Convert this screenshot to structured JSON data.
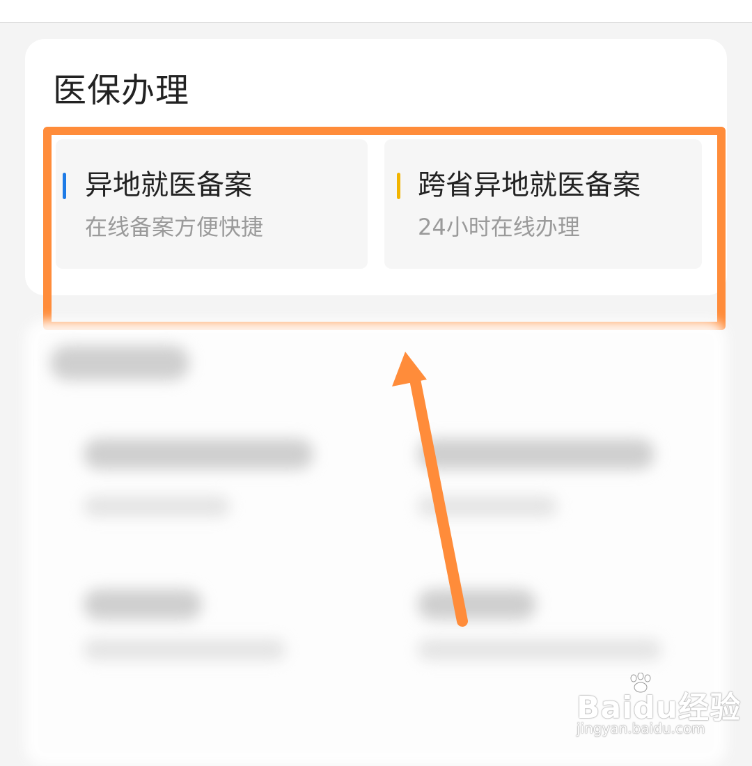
{
  "section": {
    "title": "医保办理"
  },
  "tiles": [
    {
      "title": "异地就医备案",
      "subtitle": "在线备案方便快捷",
      "accent_color": "#1e7be6"
    },
    {
      "title": "跨省异地就医备案",
      "subtitle": "24小时在线办理",
      "accent_color": "#f2b400"
    }
  ],
  "annotation": {
    "highlight_color": "#ff8c3a",
    "arrow_color": "#ff8c3a",
    "icon": "arrow-up-icon"
  },
  "watermark": {
    "brand": "Baidu经验",
    "url": "jingyan.baidu.com",
    "icon": "paw-icon"
  }
}
